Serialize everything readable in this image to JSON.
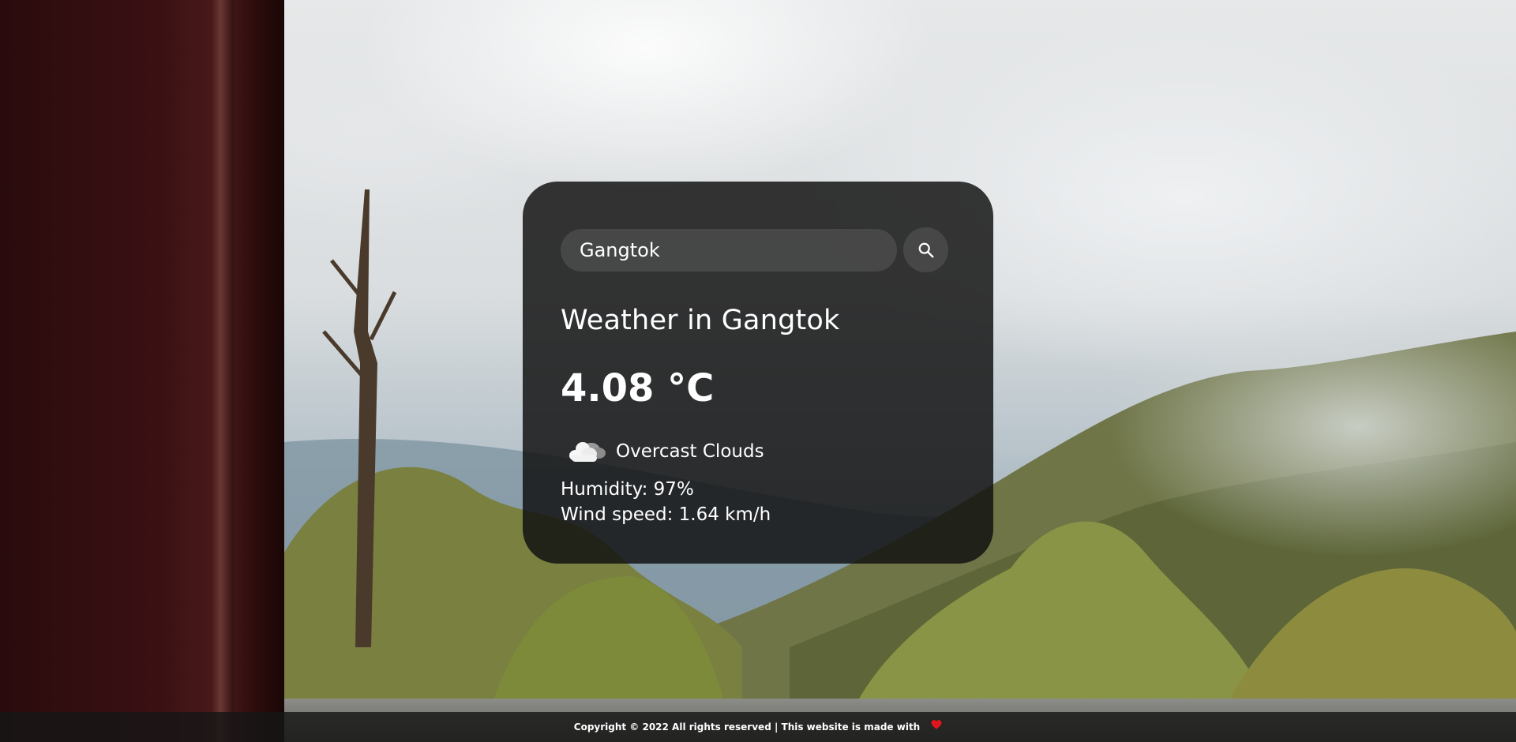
{
  "search": {
    "value": "Gangtok",
    "placeholder": "Search"
  },
  "weather": {
    "title": "Weather in Gangtok",
    "temperature": "4.08 °C",
    "condition_icon": "overcast-clouds-icon",
    "description": "Overcast Clouds",
    "humidity": "Humidity: 97%",
    "wind": "Wind speed: 1.64 km/h"
  },
  "footer": {
    "text": "Copyright © 2022 All rights reserved | This website is made with",
    "heart_icon": "heart-icon",
    "heart_color": "#e0161e"
  },
  "colors": {
    "card_background": "#111111",
    "text": "#ffffff"
  }
}
